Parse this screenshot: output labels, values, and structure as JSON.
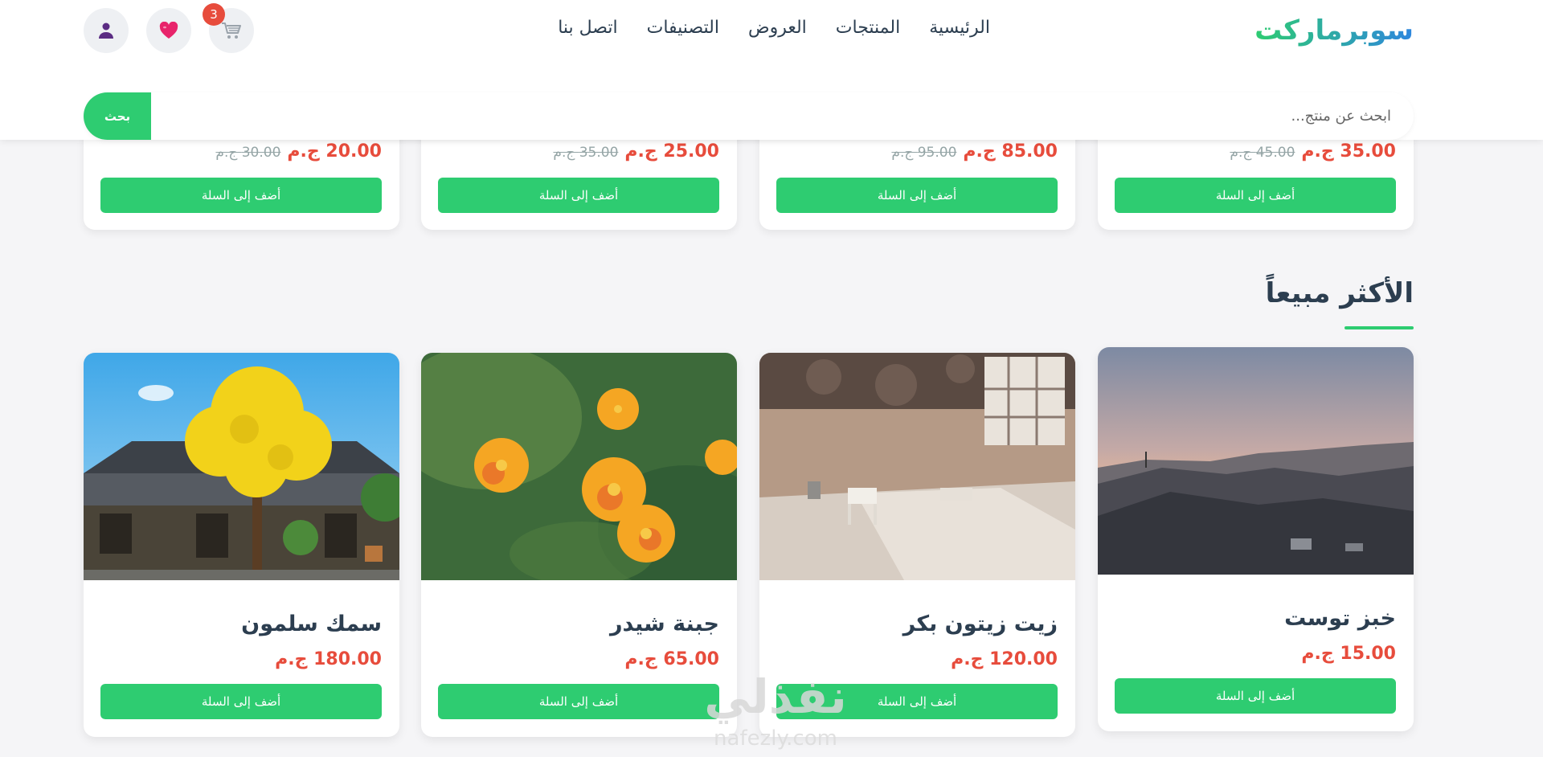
{
  "header": {
    "logo": "سوبرماركت",
    "nav": [
      "الرئيسية",
      "المنتجات",
      "العروض",
      "التصنيفات",
      "اتصل بنا"
    ],
    "cart_count": "3",
    "icons": [
      "user-icon",
      "heart-icon",
      "cart-icon"
    ]
  },
  "search": {
    "placeholder": "ابحث عن منتج...",
    "button": "بحث"
  },
  "top_cards": [
    {
      "price": "35.00 ج.م",
      "old_price": "45.00 ج.م",
      "button": "أضف إلى السلة"
    },
    {
      "price": "85.00 ج.م",
      "old_price": "95.00 ج.م",
      "button": "أضف إلى السلة"
    },
    {
      "price": "25.00 ج.م",
      "old_price": "35.00 ج.م",
      "button": "أضف إلى السلة"
    },
    {
      "price": "20.00 ج.م",
      "old_price": "30.00 ج.م",
      "button": "أضف إلى السلة"
    }
  ],
  "best_sellers": {
    "title": "الأكثر مبيعاً",
    "products": [
      {
        "name": "خبز توست",
        "price": "15.00 ج.م",
        "button": "أضف إلى السلة"
      },
      {
        "name": "زيت زيتون بكر",
        "price": "120.00 ج.م",
        "button": "أضف إلى السلة"
      },
      {
        "name": "جبنة شيدر",
        "price": "65.00 ج.م",
        "button": "أضف إلى السلة"
      },
      {
        "name": "سمك سلمون",
        "price": "180.00 ج.م",
        "button": "أضف إلى السلة"
      }
    ]
  },
  "watermark": {
    "text": "نفذلي",
    "subtext": "nafezly.com"
  },
  "colors": {
    "accent": "#2ecc71",
    "price": "#e74c3c",
    "logo_blue": "#2e86de",
    "text": "#2c3e50"
  }
}
